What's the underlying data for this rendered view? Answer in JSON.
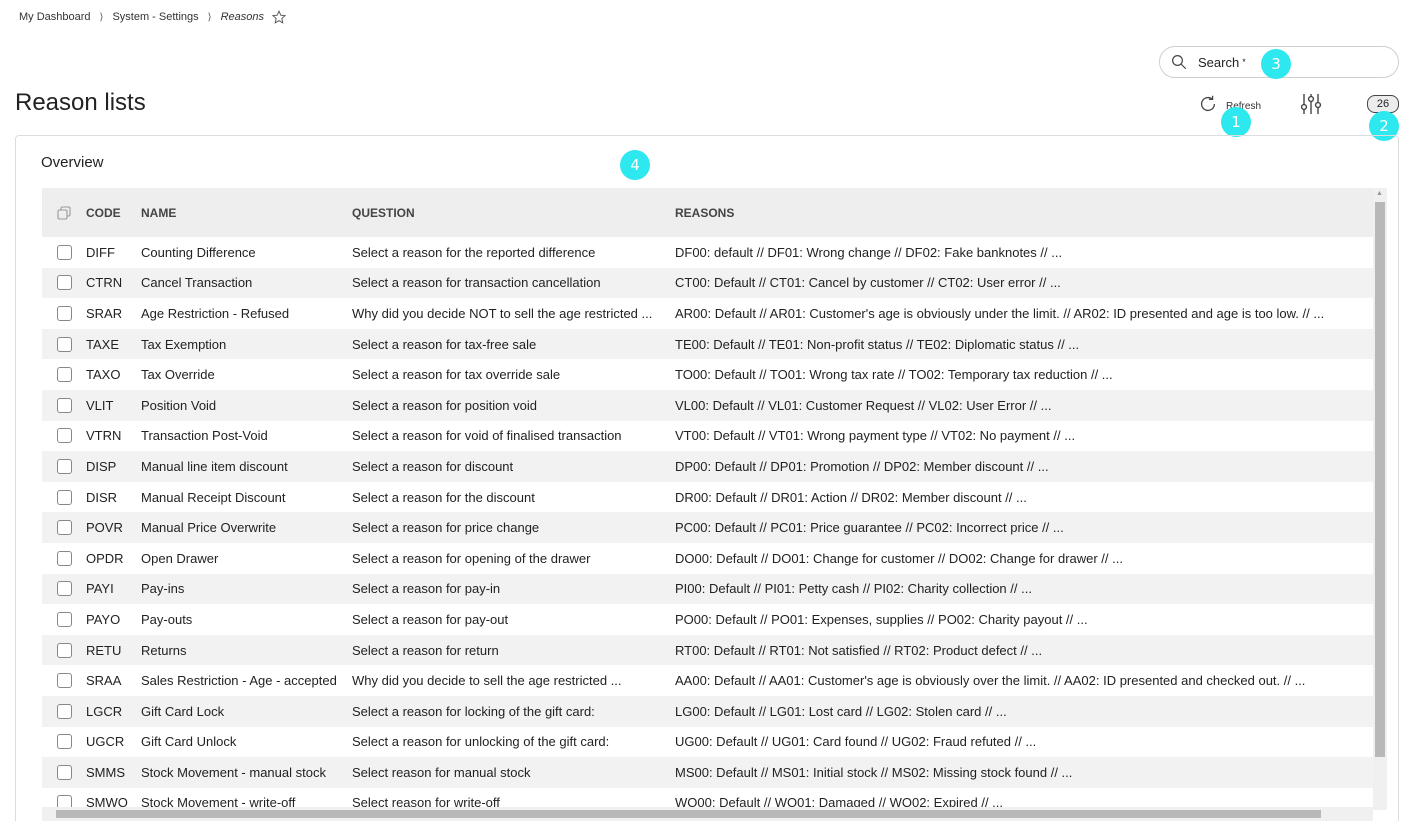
{
  "breadcrumb": {
    "items": [
      "My Dashboard",
      "System - Settings",
      "Reasons"
    ],
    "sep": "⟩"
  },
  "search": {
    "label": "Search",
    "required_mark": "*"
  },
  "page": {
    "title": "Reason lists"
  },
  "toolbar": {
    "refresh_label": "Refresh",
    "count": "26"
  },
  "markers": [
    "1",
    "2",
    "3",
    "4"
  ],
  "panel": {
    "title": "Overview"
  },
  "table": {
    "columns": [
      "CODE",
      "NAME",
      "QUESTION",
      "REASONS"
    ],
    "rows": [
      {
        "code": "DIFF",
        "name": "Counting Difference",
        "question": "Select a reason for the reported difference",
        "reasons": "DF00: default // DF01: Wrong change // DF02: Fake banknotes // ..."
      },
      {
        "code": "CTRN",
        "name": "Cancel Transaction",
        "question": "Select a reason for transaction cancellation",
        "reasons": "CT00: Default // CT01: Cancel by customer // CT02: User error // ..."
      },
      {
        "code": "SRAR",
        "name": "Age Restriction - Refused",
        "question": "Why did you decide NOT to sell the age restricted ...",
        "reasons": "AR00: Default // AR01: Customer's age is obviously under the limit. // AR02: ID presented and age is too low. // ..."
      },
      {
        "code": "TAXE",
        "name": "Tax Exemption",
        "question": "Select a reason for tax-free sale",
        "reasons": "TE00: Default // TE01: Non-profit status // TE02: Diplomatic status // ..."
      },
      {
        "code": "TAXO",
        "name": "Tax Override",
        "question": "Select a reason for tax override sale",
        "reasons": "TO00: Default // TO01: Wrong tax rate // TO02: Temporary tax reduction // ..."
      },
      {
        "code": "VLIT",
        "name": "Position Void",
        "question": "Select a reason for position void",
        "reasons": "VL00: Default // VL01: Customer Request // VL02: User Error // ..."
      },
      {
        "code": "VTRN",
        "name": "Transaction Post-Void",
        "question": "Select a reason for void of finalised transaction",
        "reasons": "VT00: Default // VT01: Wrong payment type // VT02: No payment // ..."
      },
      {
        "code": "DISP",
        "name": "Manual line item discount",
        "question": "Select a reason for discount",
        "reasons": "DP00: Default // DP01: Promotion // DP02: Member discount // ..."
      },
      {
        "code": "DISR",
        "name": "Manual Receipt Discount",
        "question": "Select a reason for the discount",
        "reasons": "DR00: Default // DR01: Action // DR02: Member discount // ..."
      },
      {
        "code": "POVR",
        "name": "Manual Price Overwrite",
        "question": "Select a reason for price change",
        "reasons": "PC00: Default // PC01: Price guarantee // PC02: Incorrect price // ..."
      },
      {
        "code": "OPDR",
        "name": "Open Drawer",
        "question": "Select a reason for opening of the drawer",
        "reasons": "DO00: Default // DO01: Change for customer // DO02: Change for drawer // ..."
      },
      {
        "code": "PAYI",
        "name": "Pay-ins",
        "question": "Select a reason for pay-in",
        "reasons": "PI00: Default // PI01: Petty cash // PI02: Charity collection // ..."
      },
      {
        "code": "PAYO",
        "name": "Pay-outs",
        "question": "Select a reason for pay-out",
        "reasons": "PO00: Default // PO01: Expenses, supplies // PO02: Charity payout // ..."
      },
      {
        "code": "RETU",
        "name": "Returns",
        "question": "Select a reason for return",
        "reasons": "RT00: Default // RT01: Not satisfied // RT02: Product defect // ..."
      },
      {
        "code": "SRAA",
        "name": "Sales Restriction - Age - accepted",
        "question": "Why did you decide to sell the age restricted ...",
        "reasons": "AA00: Default // AA01: Customer's age is obviously over the limit. // AA02: ID presented and checked out. // ..."
      },
      {
        "code": "LGCR",
        "name": "Gift Card Lock",
        "question": "Select a reason for locking of the gift card:",
        "reasons": "LG00: Default // LG01: Lost card // LG02: Stolen card // ..."
      },
      {
        "code": "UGCR",
        "name": "Gift Card Unlock",
        "question": "Select a reason for unlocking of the gift card:",
        "reasons": "UG00: Default // UG01: Card found // UG02: Fraud refuted // ..."
      },
      {
        "code": "SMMS",
        "name": "Stock Movement - manual stock",
        "question": "Select reason for manual stock",
        "reasons": "MS00: Default // MS01: Initial stock // MS02: Missing stock found // ..."
      },
      {
        "code": "SMWO",
        "name": "Stock Movement - write-off",
        "question": "Select reason for write-off",
        "reasons": "WO00: Default // WO01: Damaged // WO02: Expired // ..."
      }
    ]
  }
}
